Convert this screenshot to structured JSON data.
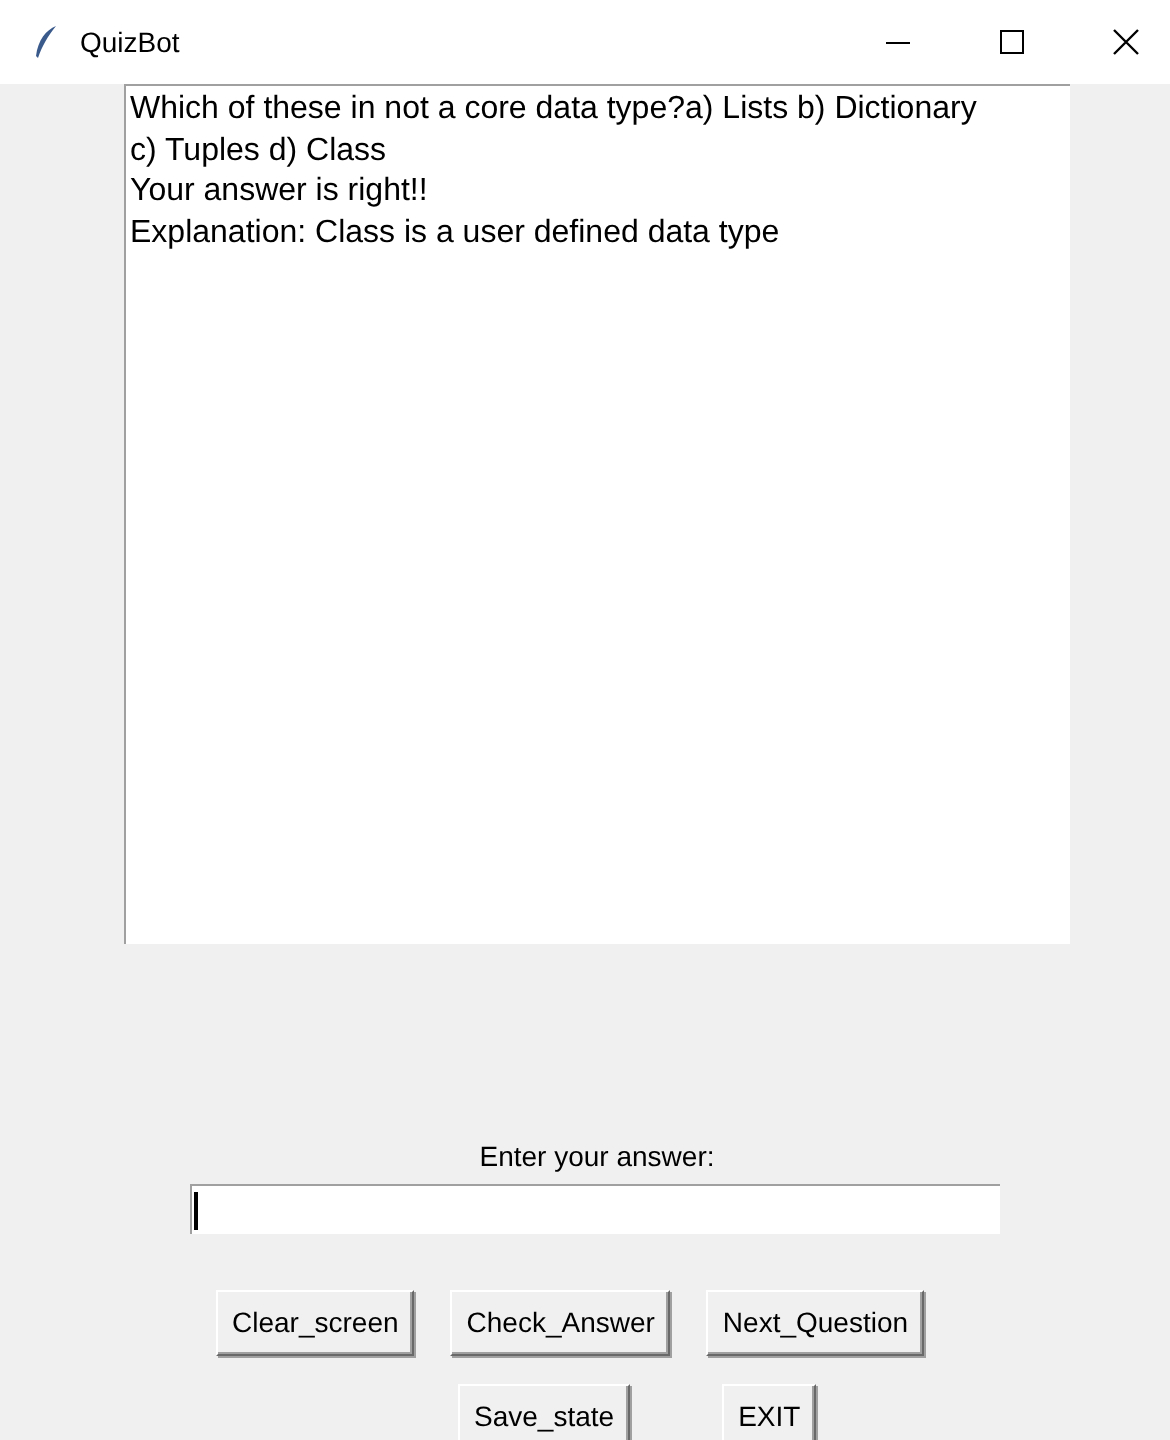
{
  "window": {
    "title": "QuizBot"
  },
  "output": {
    "lines": [
      "Which of these in not a core data type?a) Lists b) Dictionary",
      "c) Tuples d) Class",
      "Your answer is right!!",
      "Explanation: Class is a user defined data type"
    ]
  },
  "answer": {
    "label": "Enter your answer:"
  },
  "button_rows": [
    [
      "Clear_screen",
      "Check_Answer",
      "Next_Question"
    ],
    [
      "Save_state",
      "EXIT"
    ]
  ]
}
